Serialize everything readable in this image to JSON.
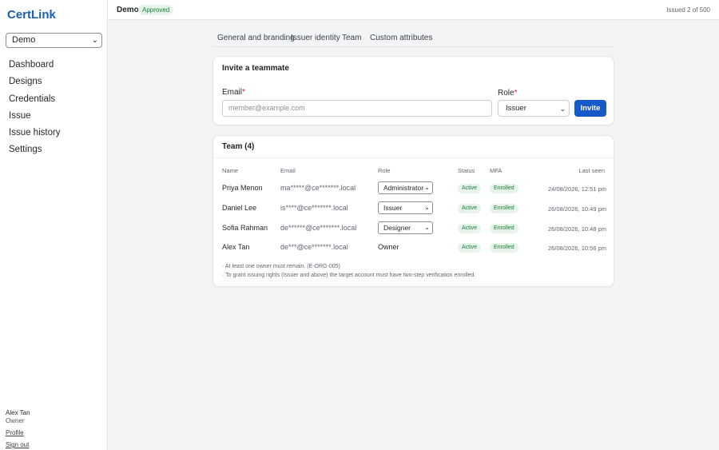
{
  "app": {
    "brand": "CertLink"
  },
  "sidebar": {
    "org_selector": "Demo",
    "items": [
      {
        "label": "Dashboard"
      },
      {
        "label": "Designs"
      },
      {
        "label": "Credentials"
      },
      {
        "label": "Issue"
      },
      {
        "label": "Issue history"
      },
      {
        "label": "Settings"
      }
    ],
    "user": {
      "name": "Alex Tan",
      "role": "Owner",
      "profile_link": "Profile",
      "signout_link": "Sign out"
    }
  },
  "header": {
    "org_name": "Demo",
    "status": "Approved",
    "usage": "Issued 2 of 500"
  },
  "tabs": [
    {
      "label": "General and branding"
    },
    {
      "label": "Issuer identity"
    },
    {
      "label": "Team"
    },
    {
      "label": "Custom attributes"
    }
  ],
  "invite": {
    "title": "Invite a teammate",
    "email_label": "Email",
    "email_placeholder": "member@example.com",
    "role_label": "Role",
    "role_value": "Issuer",
    "required_mark": "*",
    "button": "Invite"
  },
  "team": {
    "title": "Team (4)",
    "columns": {
      "name": "Name",
      "email": "Email",
      "role": "Role",
      "status": "Status",
      "mfa": "MFA",
      "last_seen": "Last seen"
    },
    "rows": [
      {
        "name": "Priya Menon",
        "email": "ma*****@ce*******.local",
        "role": "Administrator",
        "status": "Active",
        "mfa": "Enrolled",
        "last_seen": "24/08/2026, 12:51 pm"
      },
      {
        "name": "Daniel Lee",
        "email": "is****@ce*******.local",
        "role": "Issuer",
        "status": "Active",
        "mfa": "Enrolled",
        "last_seen": "26/08/2026, 10:49 pm"
      },
      {
        "name": "Sofia Rahman",
        "email": "de******@ce*******.local",
        "role": "Designer",
        "status": "Active",
        "mfa": "Enrolled",
        "last_seen": "26/08/2026, 10:48 pm"
      },
      {
        "name": "Alex Tan",
        "email": "de***@ce*******.local",
        "role": "Owner",
        "status": "Active",
        "mfa": "Enrolled",
        "last_seen": "26/08/2026, 10:56 pm"
      }
    ],
    "notes": [
      "· At least one owner must remain. (E-ORG-005)",
      "· To grant issuing rights (Issuer and above) the target account must have two-step verification enrolled."
    ]
  },
  "colors": {
    "accent": "#1659c9",
    "brand": "#1b5fb8",
    "success_text": "#1a7f37",
    "success_bg": "#e6f4ea",
    "required": "#cf222e"
  },
  "icons": {
    "select_chevron": "chevron-down-icon"
  }
}
